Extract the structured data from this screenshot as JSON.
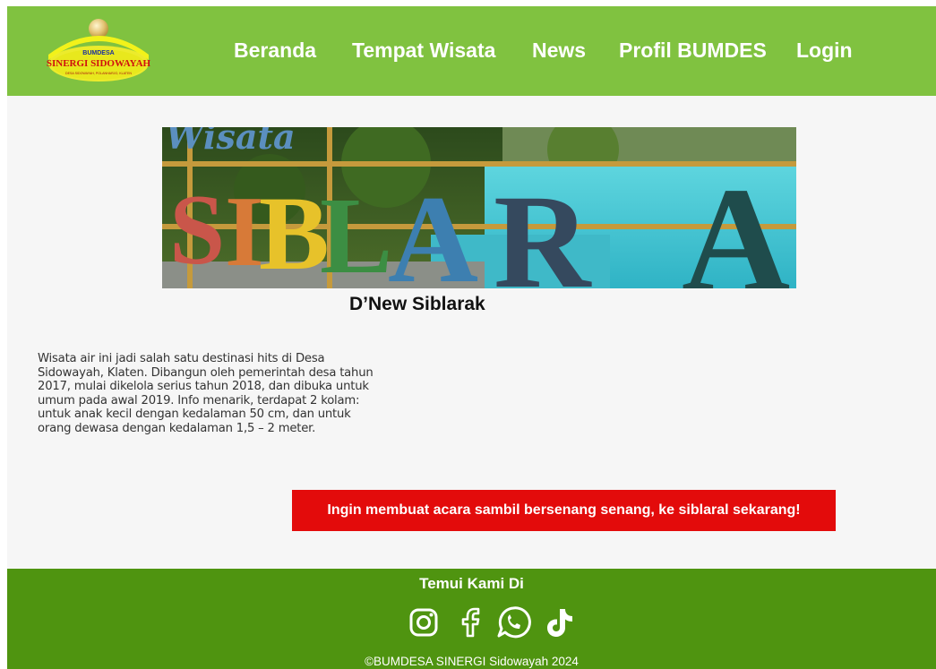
{
  "logo": {
    "line1": "BUMDESA",
    "line2": "SINERGI SIDOWAYAH",
    "line3": "DESA SIDOWAYAH, POLANHARJO, KLATEN"
  },
  "nav": {
    "items": [
      {
        "label": "Beranda"
      },
      {
        "label": "Tempat Wisata"
      },
      {
        "label": "News"
      },
      {
        "label": "Profil BUMDES"
      },
      {
        "label": "Login"
      }
    ]
  },
  "hero": {
    "sign_top": "Wisata",
    "letters": [
      "S",
      "I",
      "B",
      "L",
      "A",
      "R",
      "A"
    ]
  },
  "main": {
    "title": "D’New Siblarak",
    "description": "Wisata air ini jadi salah satu destinasi hits di Desa Sidowayah, Klaten. Dibangun oleh pemerintah desa tahun 2017, mulai dikelola serius tahun 2018, dan dibuka untuk umum pada awal 2019. Info menarik, terdapat 2 kolam: untuk anak kecil dengan kedalaman 50 cm, dan untuk orang dewasa dengan kedalaman 1,5 – 2 meter.",
    "cta_label": "Ingin membuat acara sambil bersenang senang, ke siblaral sekarang!"
  },
  "footer": {
    "title": "Temui Kami Di",
    "social": [
      {
        "icon": "instagram-icon"
      },
      {
        "icon": "facebook-icon"
      },
      {
        "icon": "whatsapp-icon"
      },
      {
        "icon": "tiktok-icon"
      }
    ],
    "copyright": "©BUMDESA SINERGI Sidowayah 2024"
  },
  "colors": {
    "header_bg": "#80c240",
    "footer_bg": "#4f9410",
    "cta_bg": "#e30b0b",
    "page_bg": "#f6f6f6"
  }
}
